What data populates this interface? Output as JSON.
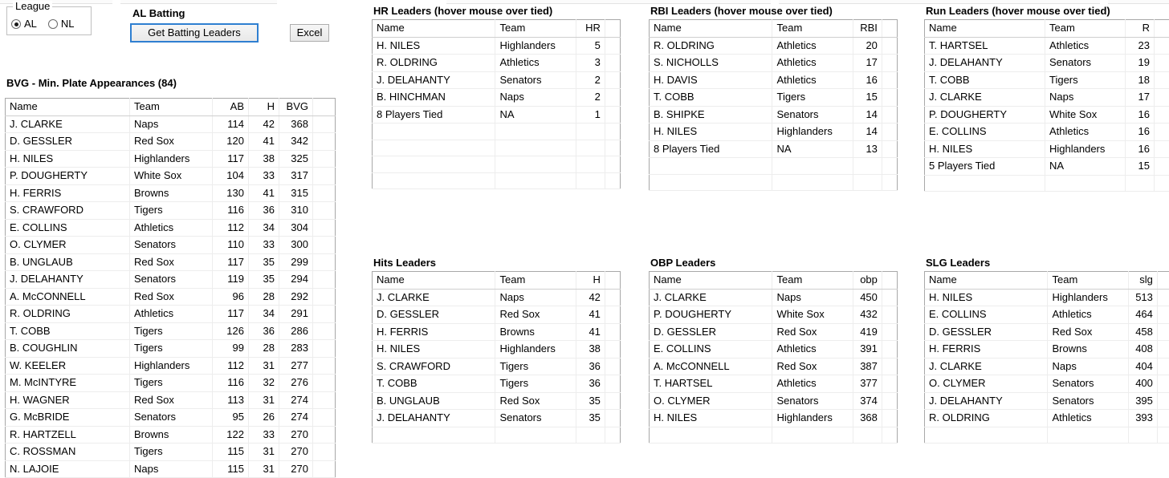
{
  "controls": {
    "league_legend": "League",
    "options": [
      {
        "label": "AL",
        "checked": true
      },
      {
        "label": "NL",
        "checked": false
      }
    ],
    "al_batting_title": "AL Batting",
    "get_leaders_label": "Get Batting Leaders",
    "excel_label": "Excel"
  },
  "bvg": {
    "title": "BVG - Min. Plate Appearances (84)",
    "columns": [
      "Name",
      "Team",
      "AB",
      "H",
      "BVG"
    ],
    "rows": [
      [
        "J. CLARKE",
        "Naps",
        "114",
        "42",
        "368"
      ],
      [
        "D. GESSLER",
        "Red Sox",
        "120",
        "41",
        "342"
      ],
      [
        "H. NILES",
        "Highlanders",
        "117",
        "38",
        "325"
      ],
      [
        "P. DOUGHERTY",
        "White Sox",
        "104",
        "33",
        "317"
      ],
      [
        "H. FERRIS",
        "Browns",
        "130",
        "41",
        "315"
      ],
      [
        "S. CRAWFORD",
        "Tigers",
        "116",
        "36",
        "310"
      ],
      [
        "E. COLLINS",
        "Athletics",
        "112",
        "34",
        "304"
      ],
      [
        "O. CLYMER",
        "Senators",
        "110",
        "33",
        "300"
      ],
      [
        "B. UNGLAUB",
        "Red Sox",
        "117",
        "35",
        "299"
      ],
      [
        "J. DELAHANTY",
        "Senators",
        "119",
        "35",
        "294"
      ],
      [
        "A. McCONNELL",
        "Red Sox",
        "96",
        "28",
        "292"
      ],
      [
        "R. OLDRING",
        "Athletics",
        "117",
        "34",
        "291"
      ],
      [
        "T. COBB",
        "Tigers",
        "126",
        "36",
        "286"
      ],
      [
        "B. COUGHLIN",
        "Tigers",
        "99",
        "28",
        "283"
      ],
      [
        "W. KEELER",
        "Highlanders",
        "112",
        "31",
        "277"
      ],
      [
        "M. McINTYRE",
        "Tigers",
        "116",
        "32",
        "276"
      ],
      [
        "H. WAGNER",
        "Red Sox",
        "113",
        "31",
        "274"
      ],
      [
        "G. McBRIDE",
        "Senators",
        "95",
        "26",
        "274"
      ],
      [
        "R. HARTZELL",
        "Browns",
        "122",
        "33",
        "270"
      ],
      [
        "C. ROSSMAN",
        "Tigers",
        "115",
        "31",
        "270"
      ],
      [
        "N. LAJOIE",
        "Naps",
        "115",
        "31",
        "270"
      ]
    ]
  },
  "leaders": [
    {
      "id": "hr",
      "title": "HR Leaders (hover mouse over tied)",
      "columns": [
        "Name",
        "Team",
        "HR"
      ],
      "rows": [
        [
          "H. NILES",
          "Highlanders",
          "5"
        ],
        [
          "R. OLDRING",
          "Athletics",
          "3"
        ],
        [
          "J. DELAHANTY",
          "Senators",
          "2"
        ],
        [
          "B. HINCHMAN",
          "Naps",
          "2"
        ],
        [
          "8 Players Tied",
          "NA",
          "1"
        ]
      ]
    },
    {
      "id": "rbi",
      "title": "RBI Leaders (hover mouse over tied)",
      "columns": [
        "Name",
        "Team",
        "RBI"
      ],
      "rows": [
        [
          "R. OLDRING",
          "Athletics",
          "20"
        ],
        [
          "S. NICHOLLS",
          "Athletics",
          "17"
        ],
        [
          "H. DAVIS",
          "Athletics",
          "16"
        ],
        [
          "T. COBB",
          "Tigers",
          "15"
        ],
        [
          "B. SHIPKE",
          "Senators",
          "14"
        ],
        [
          "H. NILES",
          "Highlanders",
          "14"
        ],
        [
          "8 Players Tied",
          "NA",
          "13"
        ]
      ]
    },
    {
      "id": "run",
      "title": "Run Leaders (hover mouse over tied)",
      "columns": [
        "Name",
        "Team",
        "R"
      ],
      "rows": [
        [
          "T. HARTSEL",
          "Athletics",
          "23"
        ],
        [
          "J. DELAHANTY",
          "Senators",
          "19"
        ],
        [
          "T. COBB",
          "Tigers",
          "18"
        ],
        [
          "J. CLARKE",
          "Naps",
          "17"
        ],
        [
          "P. DOUGHERTY",
          "White Sox",
          "16"
        ],
        [
          "E. COLLINS",
          "Athletics",
          "16"
        ],
        [
          "H. NILES",
          "Highlanders",
          "16"
        ],
        [
          "5 Players Tied",
          "NA",
          "15"
        ]
      ]
    },
    {
      "id": "hits",
      "title": "Hits Leaders",
      "columns": [
        "Name",
        "Team",
        "H"
      ],
      "rows": [
        [
          "J. CLARKE",
          "Naps",
          "42"
        ],
        [
          "D. GESSLER",
          "Red Sox",
          "41"
        ],
        [
          "H. FERRIS",
          "Browns",
          "41"
        ],
        [
          "H. NILES",
          "Highlanders",
          "38"
        ],
        [
          "S. CRAWFORD",
          "Tigers",
          "36"
        ],
        [
          "T. COBB",
          "Tigers",
          "36"
        ],
        [
          "B. UNGLAUB",
          "Red Sox",
          "35"
        ],
        [
          "J. DELAHANTY",
          "Senators",
          "35"
        ]
      ]
    },
    {
      "id": "obp",
      "title": "OBP Leaders",
      "columns": [
        "Name",
        "Team",
        "obp"
      ],
      "rows": [
        [
          "J. CLARKE",
          "Naps",
          "450"
        ],
        [
          "P. DOUGHERTY",
          "White Sox",
          "432"
        ],
        [
          "D. GESSLER",
          "Red Sox",
          "419"
        ],
        [
          "E. COLLINS",
          "Athletics",
          "391"
        ],
        [
          "A. McCONNELL",
          "Red Sox",
          "387"
        ],
        [
          "T. HARTSEL",
          "Athletics",
          "377"
        ],
        [
          "O. CLYMER",
          "Senators",
          "374"
        ],
        [
          "H. NILES",
          "Highlanders",
          "368"
        ]
      ]
    },
    {
      "id": "slg",
      "title": "SLG Leaders",
      "columns": [
        "Name",
        "Team",
        "slg"
      ],
      "rows": [
        [
          "H. NILES",
          "Highlanders",
          "513"
        ],
        [
          "E. COLLINS",
          "Athletics",
          "464"
        ],
        [
          "D. GESSLER",
          "Red Sox",
          "458"
        ],
        [
          "H. FERRIS",
          "Browns",
          "408"
        ],
        [
          "J. CLARKE",
          "Naps",
          "404"
        ],
        [
          "O. CLYMER",
          "Senators",
          "400"
        ],
        [
          "J. DELAHANTY",
          "Senators",
          "395"
        ],
        [
          "R. OLDRING",
          "Athletics",
          "393"
        ]
      ]
    }
  ]
}
